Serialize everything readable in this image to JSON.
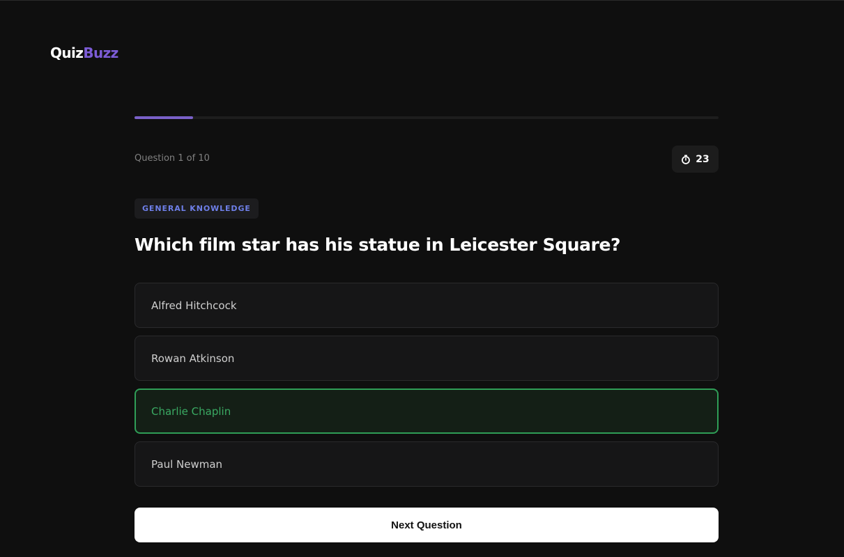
{
  "brand": {
    "name_part1": "Quiz",
    "name_part2": "Buzz"
  },
  "progress": {
    "fraction": 0.1
  },
  "counter": {
    "text": "Question 1 of 10"
  },
  "timer": {
    "icon": "stopwatch-icon",
    "value": "23"
  },
  "category": {
    "label": "GENERAL KNOWLEDGE"
  },
  "question": {
    "text": "Which film star has his statue in Leicester Square?"
  },
  "options": [
    {
      "label": "Alfred Hitchcock",
      "state": "default"
    },
    {
      "label": "Rowan Atkinson",
      "state": "default"
    },
    {
      "label": "Charlie Chaplin",
      "state": "correct"
    },
    {
      "label": "Paul Newman",
      "state": "default"
    }
  ],
  "actions": {
    "next_label": "Next Question"
  },
  "colors": {
    "background": "#0f0f0f",
    "accent": "#7c5cd6",
    "category_text": "#6e7fe8",
    "correct": "#2f9e57"
  }
}
